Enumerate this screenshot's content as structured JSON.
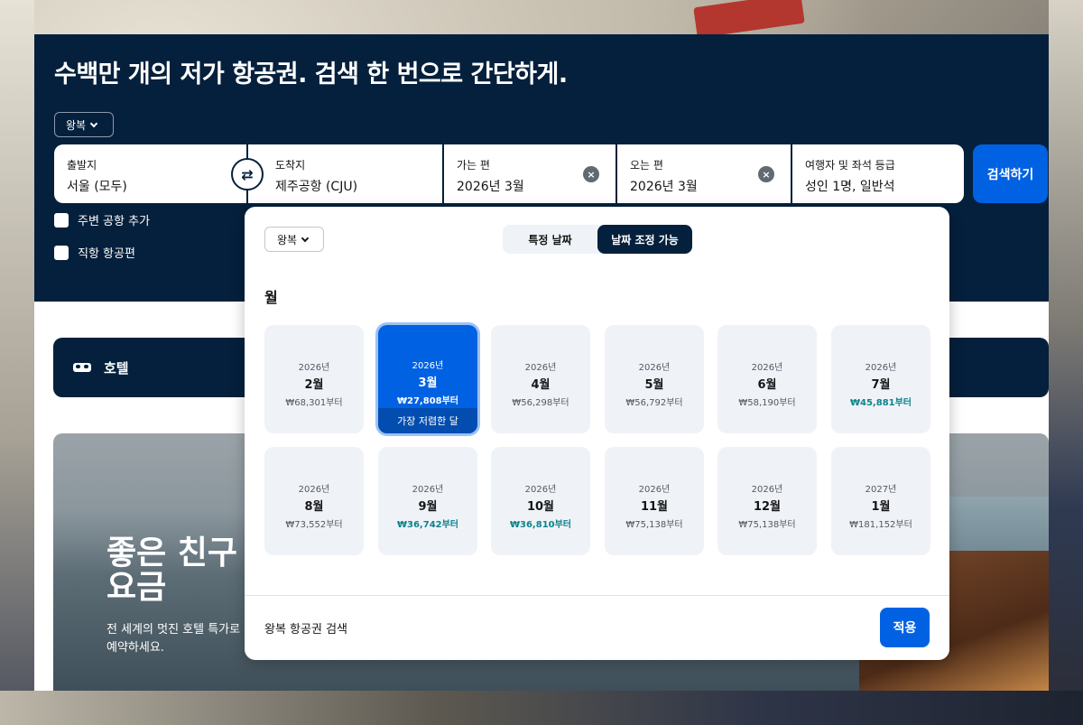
{
  "header": {
    "headline": "수백만 개의 저가 항공권. 검색 한 번으로 간단하게.",
    "trip_type": "왕복"
  },
  "search": {
    "from_label": "출발지",
    "from_value": "서울 (모두)",
    "to_label": "도착지",
    "to_value": "제주공항 (CJU)",
    "depart_label": "가는 편",
    "depart_value": "2026년 3월",
    "return_label": "오는 편",
    "return_value": "2026년 3월",
    "pax_label": "여행자 및 좌석 등급",
    "pax_value": "성인 1명, 일반석",
    "search_button": "검색하기",
    "swap_icon": "⇄",
    "clear_icon": "×"
  },
  "options": {
    "nearby_airports": "주변 공항 추가",
    "direct_only": "직항 항공편"
  },
  "hotel_bar": {
    "label": "호텔"
  },
  "promo": {
    "title_line1": "좋은 친구",
    "title_line2": "요금",
    "subtitle": "전 세계의 멋진 호텔 특가로 예약하세요."
  },
  "popover": {
    "trip_type": "왕복",
    "tab_specific": "특정 날짜",
    "tab_flexible": "날짜 조정 가능",
    "active_tab": "날짜 조정 가능",
    "section_title": "월",
    "months": [
      {
        "year": "2026년",
        "month": "2월",
        "price": "₩68,301부터",
        "cheap": false
      },
      {
        "year": "2026년",
        "month": "3월",
        "price": "₩27,808부터",
        "cheap": true,
        "selected": true,
        "tag": "가장 저렴한 달"
      },
      {
        "year": "2026년",
        "month": "4월",
        "price": "₩56,298부터",
        "cheap": false
      },
      {
        "year": "2026년",
        "month": "5월",
        "price": "₩56,792부터",
        "cheap": false
      },
      {
        "year": "2026년",
        "month": "6월",
        "price": "₩58,190부터",
        "cheap": false
      },
      {
        "year": "2026년",
        "month": "7월",
        "price": "₩45,881부터",
        "cheap": true
      },
      {
        "year": "2026년",
        "month": "8월",
        "price": "₩73,552부터",
        "cheap": false
      },
      {
        "year": "2026년",
        "month": "9월",
        "price": "₩36,742부터",
        "cheap": true
      },
      {
        "year": "2026년",
        "month": "10월",
        "price": "₩36,810부터",
        "cheap": true
      },
      {
        "year": "2026년",
        "month": "11월",
        "price": "₩75,138부터",
        "cheap": false
      },
      {
        "year": "2026년",
        "month": "12월",
        "price": "₩75,138부터",
        "cheap": false
      },
      {
        "year": "2027년",
        "month": "1월",
        "price": "₩181,152부터",
        "cheap": false
      }
    ],
    "footer_label": "왕복 항공권 검색",
    "apply_button": "적용"
  },
  "colors": {
    "navy": "#05203c",
    "primary": "#0062e3",
    "cheap_price": "#0c838a"
  }
}
